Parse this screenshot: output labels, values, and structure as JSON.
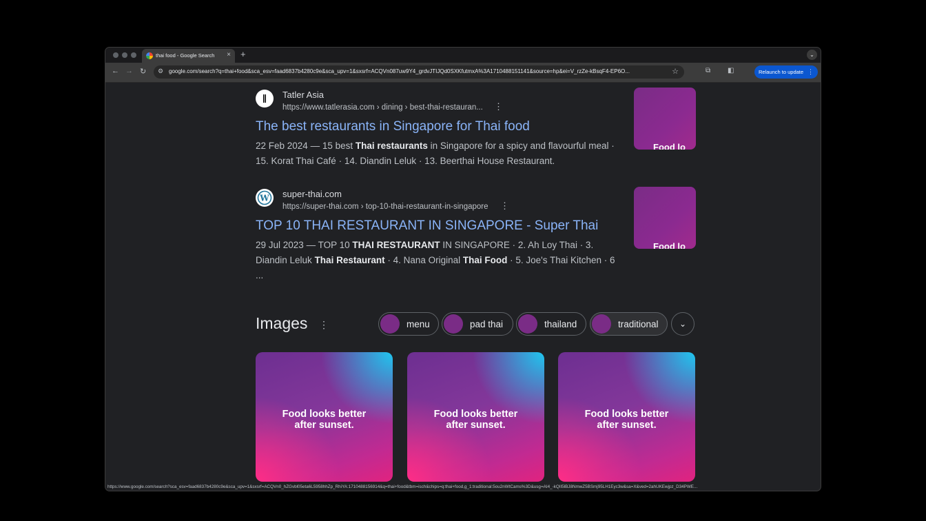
{
  "browser": {
    "tab_title": "thai food - Google Search",
    "tab_close": "×",
    "new_tab": "+",
    "url": "google.com/search?q=thai+food&sca_esv=faad6837b4280c9e&sca_upv=1&sxsrf=ACQVn087uw9Y4_grdvJTIJQd0SXKfutmxA%3A1710488151141&source=hp&ei=V_rzZe-kBsqF4-EP6O...",
    "relaunch_label": "Relaunch to update",
    "status_url": "https://www.google.com/search?sca_esv=faad6837b4280c9e&sca_upv=1&sxsrf=ACQVn0_hZGvbl05eta6L5958hhZp_RhiYA:1710488156914&q=thai+food&tbm=isch&chips=q:thai+food,g_1:traditional:5ou2nWtCams%3D&usg=AI4_-kQII5lBJ8NmwZ5BSmj95LH1Eyc3w&sa=X&ved=2ahUKEwjpz_D34PWE..."
  },
  "results": [
    {
      "site_name": "Tatler Asia",
      "site_url": "https://www.tatlerasia.com › dining › best-thai-restauran...",
      "title": "The best restaurants in Singapore for Thai food",
      "date": "22 Feb 2024",
      "snippet_parts": [
        {
          "text": " — 15 best ",
          "bold": false
        },
        {
          "text": "Thai restaurants",
          "bold": true
        },
        {
          "text": " in Singapore for a spicy and flavourful meal · 15. Korat Thai Café · 14. Diandin Leluk · 13. Beerthai House Restaurant.",
          "bold": false
        }
      ],
      "thumb_text": "Food lo"
    },
    {
      "site_name": "super-thai.com",
      "site_url": "https://super-thai.com › top-10-thai-restaurant-in-singapore",
      "title": "TOP 10 THAI RESTAURANT IN SINGAPORE - Super Thai",
      "date": "29 Jul 2023",
      "snippet_parts": [
        {
          "text": " — TOP 10 ",
          "bold": false
        },
        {
          "text": "THAI RESTAURANT",
          "bold": true
        },
        {
          "text": " IN SINGAPORE · 2. Ah Loy Thai · 3. Diandin Leluk ",
          "bold": false
        },
        {
          "text": "Thai Restaurant",
          "bold": true
        },
        {
          "text": " · 4. Nana Original ",
          "bold": false
        },
        {
          "text": "Thai Food",
          "bold": true
        },
        {
          "text": " · 5. Joe's Thai Kitchen · 6 ...",
          "bold": false
        }
      ],
      "thumb_text": "Food lo"
    }
  ],
  "images_section": {
    "heading": "Images",
    "chips": [
      "menu",
      "pad thai",
      "thailand",
      "traditional"
    ],
    "card_text": [
      "Food looks better",
      "after sunset."
    ]
  },
  "colors": {
    "link": "#8ab4f8",
    "accent": "#0b57d0",
    "background": "#202124"
  }
}
